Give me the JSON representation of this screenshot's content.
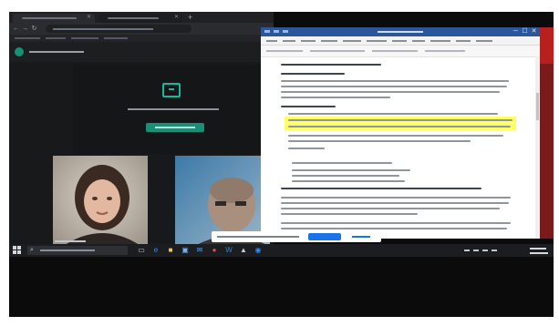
{
  "window": {
    "bezel_color": "#0b0b0c"
  },
  "meet": {
    "accent": "#1a8f77",
    "tiles": [
      {
        "person": "participant-1"
      },
      {
        "person": "participant-2"
      }
    ]
  },
  "word": {
    "title_color": "#2b579a",
    "highlight": "#ffff66",
    "window_controls": {
      "minimize": "─",
      "maximize": "☐",
      "close": "✕"
    }
  },
  "taskbar": {
    "start_icon": "windows-logo-icon",
    "apps": [
      "task-view-icon",
      "edge-icon",
      "folder-icon",
      "store-icon",
      "mail-icon",
      "chrome-icon",
      "word-icon",
      "photos-icon",
      "zoom-icon"
    ]
  },
  "browser": {
    "new_tab_glyph": "+"
  }
}
